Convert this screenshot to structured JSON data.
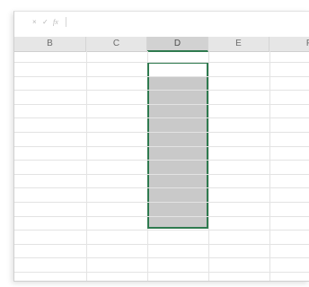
{
  "formula_bar": {
    "cancel_icon": "×",
    "enter_icon": "✓",
    "fx_label": "fx"
  },
  "columns": [
    "B",
    "C",
    "D",
    "E",
    "F"
  ],
  "selected_column": "D",
  "colors": {
    "selection_border": "#2f7a4f",
    "selection_fill": "#c9c9c9",
    "header_background": "#e6e6e6"
  }
}
